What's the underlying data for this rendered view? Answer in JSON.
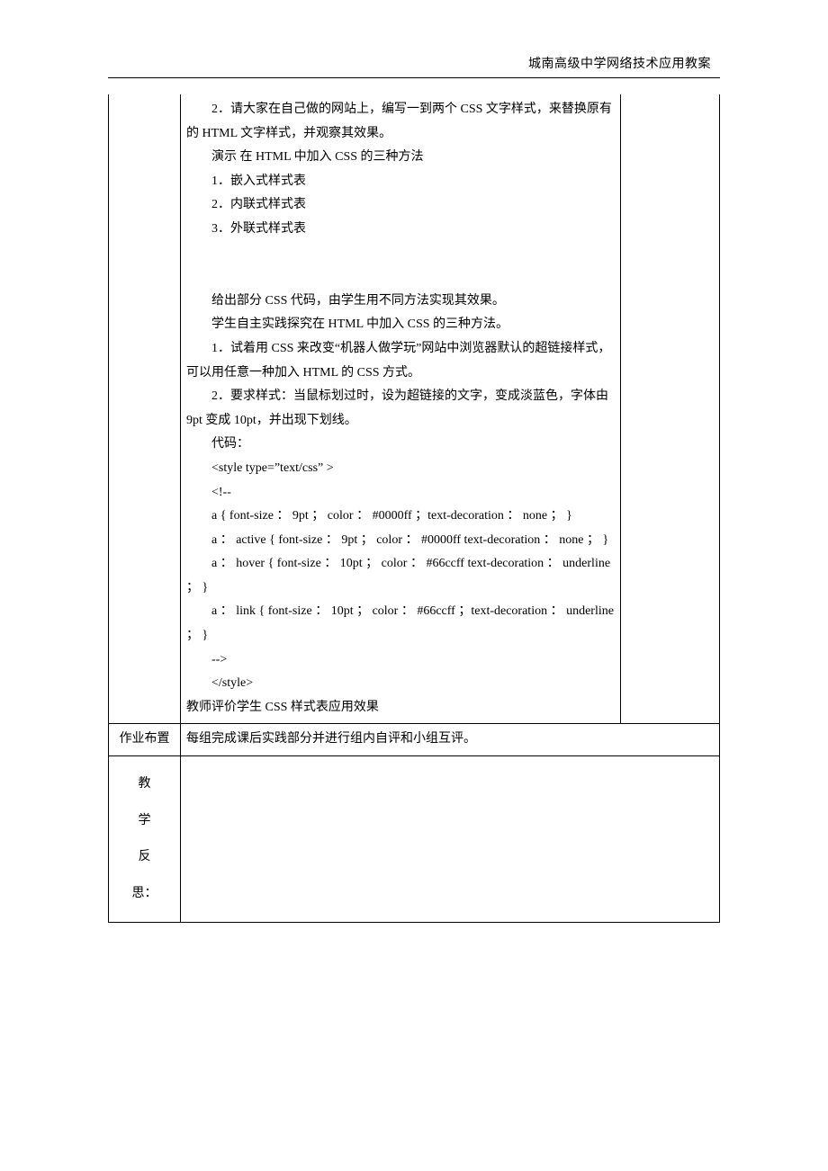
{
  "header": {
    "title": "城南高级中学网络技术应用教案"
  },
  "main": {
    "line1": "2．请大家在自己做的网站上，编写一到两个 CSS 文字样式，来替换原有的 HTML 文字样式，并观察其效果。",
    "line2": "演示 在 HTML 中加入 CSS 的三种方法",
    "line3": "1．嵌入式样式表",
    "line4": "2．内联式样式表",
    "line5": "3．外联式样式表",
    "line6": "给出部分 CSS 代码，由学生用不同方法实现其效果。",
    "line7": "学生自主实践探究在 HTML 中加入 CSS 的三种方法。",
    "line8": "1．试着用 CSS 来改变“机器人做学玩”网站中浏览器默认的超链接样式，可以用任意一种加入 HTML 的 CSS 方式。",
    "line9": "2．要求样式：当鼠标划过时，设为超链接的文字，变成淡蓝色，字体由 9pt 变成 10pt，并出现下划线。",
    "code_label": "代码：",
    "code1": "<style type=”text/css” >",
    "code2": "<!--",
    "code3": "a { font-size ： 9pt ；  color ： #0000ff ；text-decoration ： none ；  }",
    "code4": "a ： active { font-size ： 9pt ；  color ： #0000ff text-decoration ： none ；  }",
    "code5": "a ： hover { font-size ： 10pt ；  color ： #66ccff text-decoration ： underline ；  }",
    "code6": "a ： link { font-size ： 10pt ；  color ： #66ccff ；text-decoration ： underline ；  }",
    "code7": "-->",
    "code8": "</style>",
    "line10": "教师评价学生 CSS 样式表应用效果"
  },
  "homework": {
    "label": "作业布置",
    "content": "每组完成课后实践部分并进行组内自评和小组互评。"
  },
  "reflection": {
    "c1": "教",
    "c2": "学",
    "c3": "反",
    "c4": "思："
  }
}
